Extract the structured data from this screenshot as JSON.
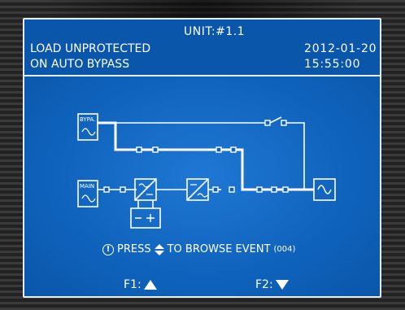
{
  "header": {
    "unit": "UNIT:#1.1",
    "status_line1": "LOAD UNPROTECTED",
    "status_line2": "ON AUTO BYPASS",
    "date": "2012-01-20",
    "time": "15:55:00"
  },
  "diagram": {
    "bypass_label": "BYPA.",
    "main_label": "MAIN"
  },
  "event_prompt": {
    "press": "PRESS",
    "action": "TO BROWSE EVENT",
    "count": "(004)"
  },
  "function_keys": {
    "f1_label": "F1:",
    "f2_label": "F2:"
  },
  "colors": {
    "screen_bg": "#0d5fb8",
    "line": "#ffffff"
  }
}
